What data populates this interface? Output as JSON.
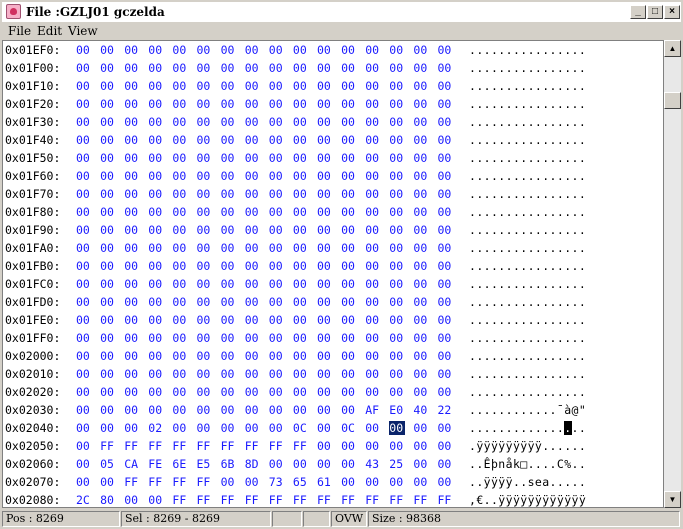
{
  "window": {
    "title": "File :GZLJ01 gczelda",
    "minimize": "_",
    "maximize": "□",
    "close": "×"
  },
  "menu": [
    {
      "label": "File"
    },
    {
      "label": "Edit"
    },
    {
      "label": "View"
    }
  ],
  "hex_rows": [
    {
      "addr": "0x01EF0:",
      "bytes": [
        "00",
        "00",
        "00",
        "00",
        "00",
        "00",
        "00",
        "00",
        "00",
        "00",
        "00",
        "00",
        "00",
        "00",
        "00",
        "00"
      ],
      "ascii": "................"
    },
    {
      "addr": "0x01F00:",
      "bytes": [
        "00",
        "00",
        "00",
        "00",
        "00",
        "00",
        "00",
        "00",
        "00",
        "00",
        "00",
        "00",
        "00",
        "00",
        "00",
        "00"
      ],
      "ascii": "................"
    },
    {
      "addr": "0x01F10:",
      "bytes": [
        "00",
        "00",
        "00",
        "00",
        "00",
        "00",
        "00",
        "00",
        "00",
        "00",
        "00",
        "00",
        "00",
        "00",
        "00",
        "00"
      ],
      "ascii": "................"
    },
    {
      "addr": "0x01F20:",
      "bytes": [
        "00",
        "00",
        "00",
        "00",
        "00",
        "00",
        "00",
        "00",
        "00",
        "00",
        "00",
        "00",
        "00",
        "00",
        "00",
        "00"
      ],
      "ascii": "................"
    },
    {
      "addr": "0x01F30:",
      "bytes": [
        "00",
        "00",
        "00",
        "00",
        "00",
        "00",
        "00",
        "00",
        "00",
        "00",
        "00",
        "00",
        "00",
        "00",
        "00",
        "00"
      ],
      "ascii": "................"
    },
    {
      "addr": "0x01F40:",
      "bytes": [
        "00",
        "00",
        "00",
        "00",
        "00",
        "00",
        "00",
        "00",
        "00",
        "00",
        "00",
        "00",
        "00",
        "00",
        "00",
        "00"
      ],
      "ascii": "................"
    },
    {
      "addr": "0x01F50:",
      "bytes": [
        "00",
        "00",
        "00",
        "00",
        "00",
        "00",
        "00",
        "00",
        "00",
        "00",
        "00",
        "00",
        "00",
        "00",
        "00",
        "00"
      ],
      "ascii": "................"
    },
    {
      "addr": "0x01F60:",
      "bytes": [
        "00",
        "00",
        "00",
        "00",
        "00",
        "00",
        "00",
        "00",
        "00",
        "00",
        "00",
        "00",
        "00",
        "00",
        "00",
        "00"
      ],
      "ascii": "................"
    },
    {
      "addr": "0x01F70:",
      "bytes": [
        "00",
        "00",
        "00",
        "00",
        "00",
        "00",
        "00",
        "00",
        "00",
        "00",
        "00",
        "00",
        "00",
        "00",
        "00",
        "00"
      ],
      "ascii": "................"
    },
    {
      "addr": "0x01F80:",
      "bytes": [
        "00",
        "00",
        "00",
        "00",
        "00",
        "00",
        "00",
        "00",
        "00",
        "00",
        "00",
        "00",
        "00",
        "00",
        "00",
        "00"
      ],
      "ascii": "................"
    },
    {
      "addr": "0x01F90:",
      "bytes": [
        "00",
        "00",
        "00",
        "00",
        "00",
        "00",
        "00",
        "00",
        "00",
        "00",
        "00",
        "00",
        "00",
        "00",
        "00",
        "00"
      ],
      "ascii": "................"
    },
    {
      "addr": "0x01FA0:",
      "bytes": [
        "00",
        "00",
        "00",
        "00",
        "00",
        "00",
        "00",
        "00",
        "00",
        "00",
        "00",
        "00",
        "00",
        "00",
        "00",
        "00"
      ],
      "ascii": "................"
    },
    {
      "addr": "0x01FB0:",
      "bytes": [
        "00",
        "00",
        "00",
        "00",
        "00",
        "00",
        "00",
        "00",
        "00",
        "00",
        "00",
        "00",
        "00",
        "00",
        "00",
        "00"
      ],
      "ascii": "................"
    },
    {
      "addr": "0x01FC0:",
      "bytes": [
        "00",
        "00",
        "00",
        "00",
        "00",
        "00",
        "00",
        "00",
        "00",
        "00",
        "00",
        "00",
        "00",
        "00",
        "00",
        "00"
      ],
      "ascii": "................"
    },
    {
      "addr": "0x01FD0:",
      "bytes": [
        "00",
        "00",
        "00",
        "00",
        "00",
        "00",
        "00",
        "00",
        "00",
        "00",
        "00",
        "00",
        "00",
        "00",
        "00",
        "00"
      ],
      "ascii": "................"
    },
    {
      "addr": "0x01FE0:",
      "bytes": [
        "00",
        "00",
        "00",
        "00",
        "00",
        "00",
        "00",
        "00",
        "00",
        "00",
        "00",
        "00",
        "00",
        "00",
        "00",
        "00"
      ],
      "ascii": "................"
    },
    {
      "addr": "0x01FF0:",
      "bytes": [
        "00",
        "00",
        "00",
        "00",
        "00",
        "00",
        "00",
        "00",
        "00",
        "00",
        "00",
        "00",
        "00",
        "00",
        "00",
        "00"
      ],
      "ascii": "................"
    },
    {
      "addr": "0x02000:",
      "bytes": [
        "00",
        "00",
        "00",
        "00",
        "00",
        "00",
        "00",
        "00",
        "00",
        "00",
        "00",
        "00",
        "00",
        "00",
        "00",
        "00"
      ],
      "ascii": "................"
    },
    {
      "addr": "0x02010:",
      "bytes": [
        "00",
        "00",
        "00",
        "00",
        "00",
        "00",
        "00",
        "00",
        "00",
        "00",
        "00",
        "00",
        "00",
        "00",
        "00",
        "00"
      ],
      "ascii": "................"
    },
    {
      "addr": "0x02020:",
      "bytes": [
        "00",
        "00",
        "00",
        "00",
        "00",
        "00",
        "00",
        "00",
        "00",
        "00",
        "00",
        "00",
        "00",
        "00",
        "00",
        "00"
      ],
      "ascii": "................"
    },
    {
      "addr": "0x02030:",
      "bytes": [
        "00",
        "00",
        "00",
        "00",
        "00",
        "00",
        "00",
        "00",
        "00",
        "00",
        "00",
        "00",
        "AF",
        "E0",
        "40",
        "22"
      ],
      "ascii": "............¯à@\""
    },
    {
      "addr": "0x02040:",
      "bytes": [
        "00",
        "00",
        "00",
        "02",
        "00",
        "00",
        "00",
        "00",
        "00",
        "0C",
        "00",
        "0C",
        "00",
        "00",
        "00",
        "00"
      ],
      "ascii": "................",
      "selected_byte": 13,
      "cursor_char": 13
    },
    {
      "addr": "0x02050:",
      "bytes": [
        "00",
        "FF",
        "FF",
        "FF",
        "FF",
        "FF",
        "FF",
        "FF",
        "FF",
        "FF",
        "00",
        "00",
        "00",
        "00",
        "00",
        "00"
      ],
      "ascii": ".ÿÿÿÿÿÿÿÿÿ......"
    },
    {
      "addr": "0x02060:",
      "bytes": [
        "00",
        "05",
        "CA",
        "FE",
        "6E",
        "E5",
        "6B",
        "8D",
        "00",
        "00",
        "00",
        "00",
        "43",
        "25",
        "00",
        "00"
      ],
      "ascii": "..Êþnåk□....C%.."
    },
    {
      "addr": "0x02070:",
      "bytes": [
        "00",
        "00",
        "FF",
        "FF",
        "FF",
        "FF",
        "00",
        "00",
        "73",
        "65",
        "61",
        "00",
        "00",
        "00",
        "00",
        "00"
      ],
      "ascii": "..ÿÿÿÿ..sea....."
    },
    {
      "addr": "0x02080:",
      "bytes": [
        "2C",
        "80",
        "00",
        "00",
        "FF",
        "FF",
        "FF",
        "FF",
        "FF",
        "FF",
        "FF",
        "FF",
        "FF",
        "FF",
        "FF",
        "FF"
      ],
      "ascii": ",€..ÿÿÿÿÿÿÿÿÿÿÿÿ"
    }
  ],
  "status": {
    "pos": "Pos : 8269",
    "sel": "Sel : 8269 - 8269",
    "empty1": "",
    "empty2": "",
    "mode": "OVW",
    "size": "Size : 98368"
  },
  "colors": {
    "hex_text": "#1a1aff",
    "selection_bg": "#0a246a",
    "window_bg": "#d4d0c8"
  }
}
